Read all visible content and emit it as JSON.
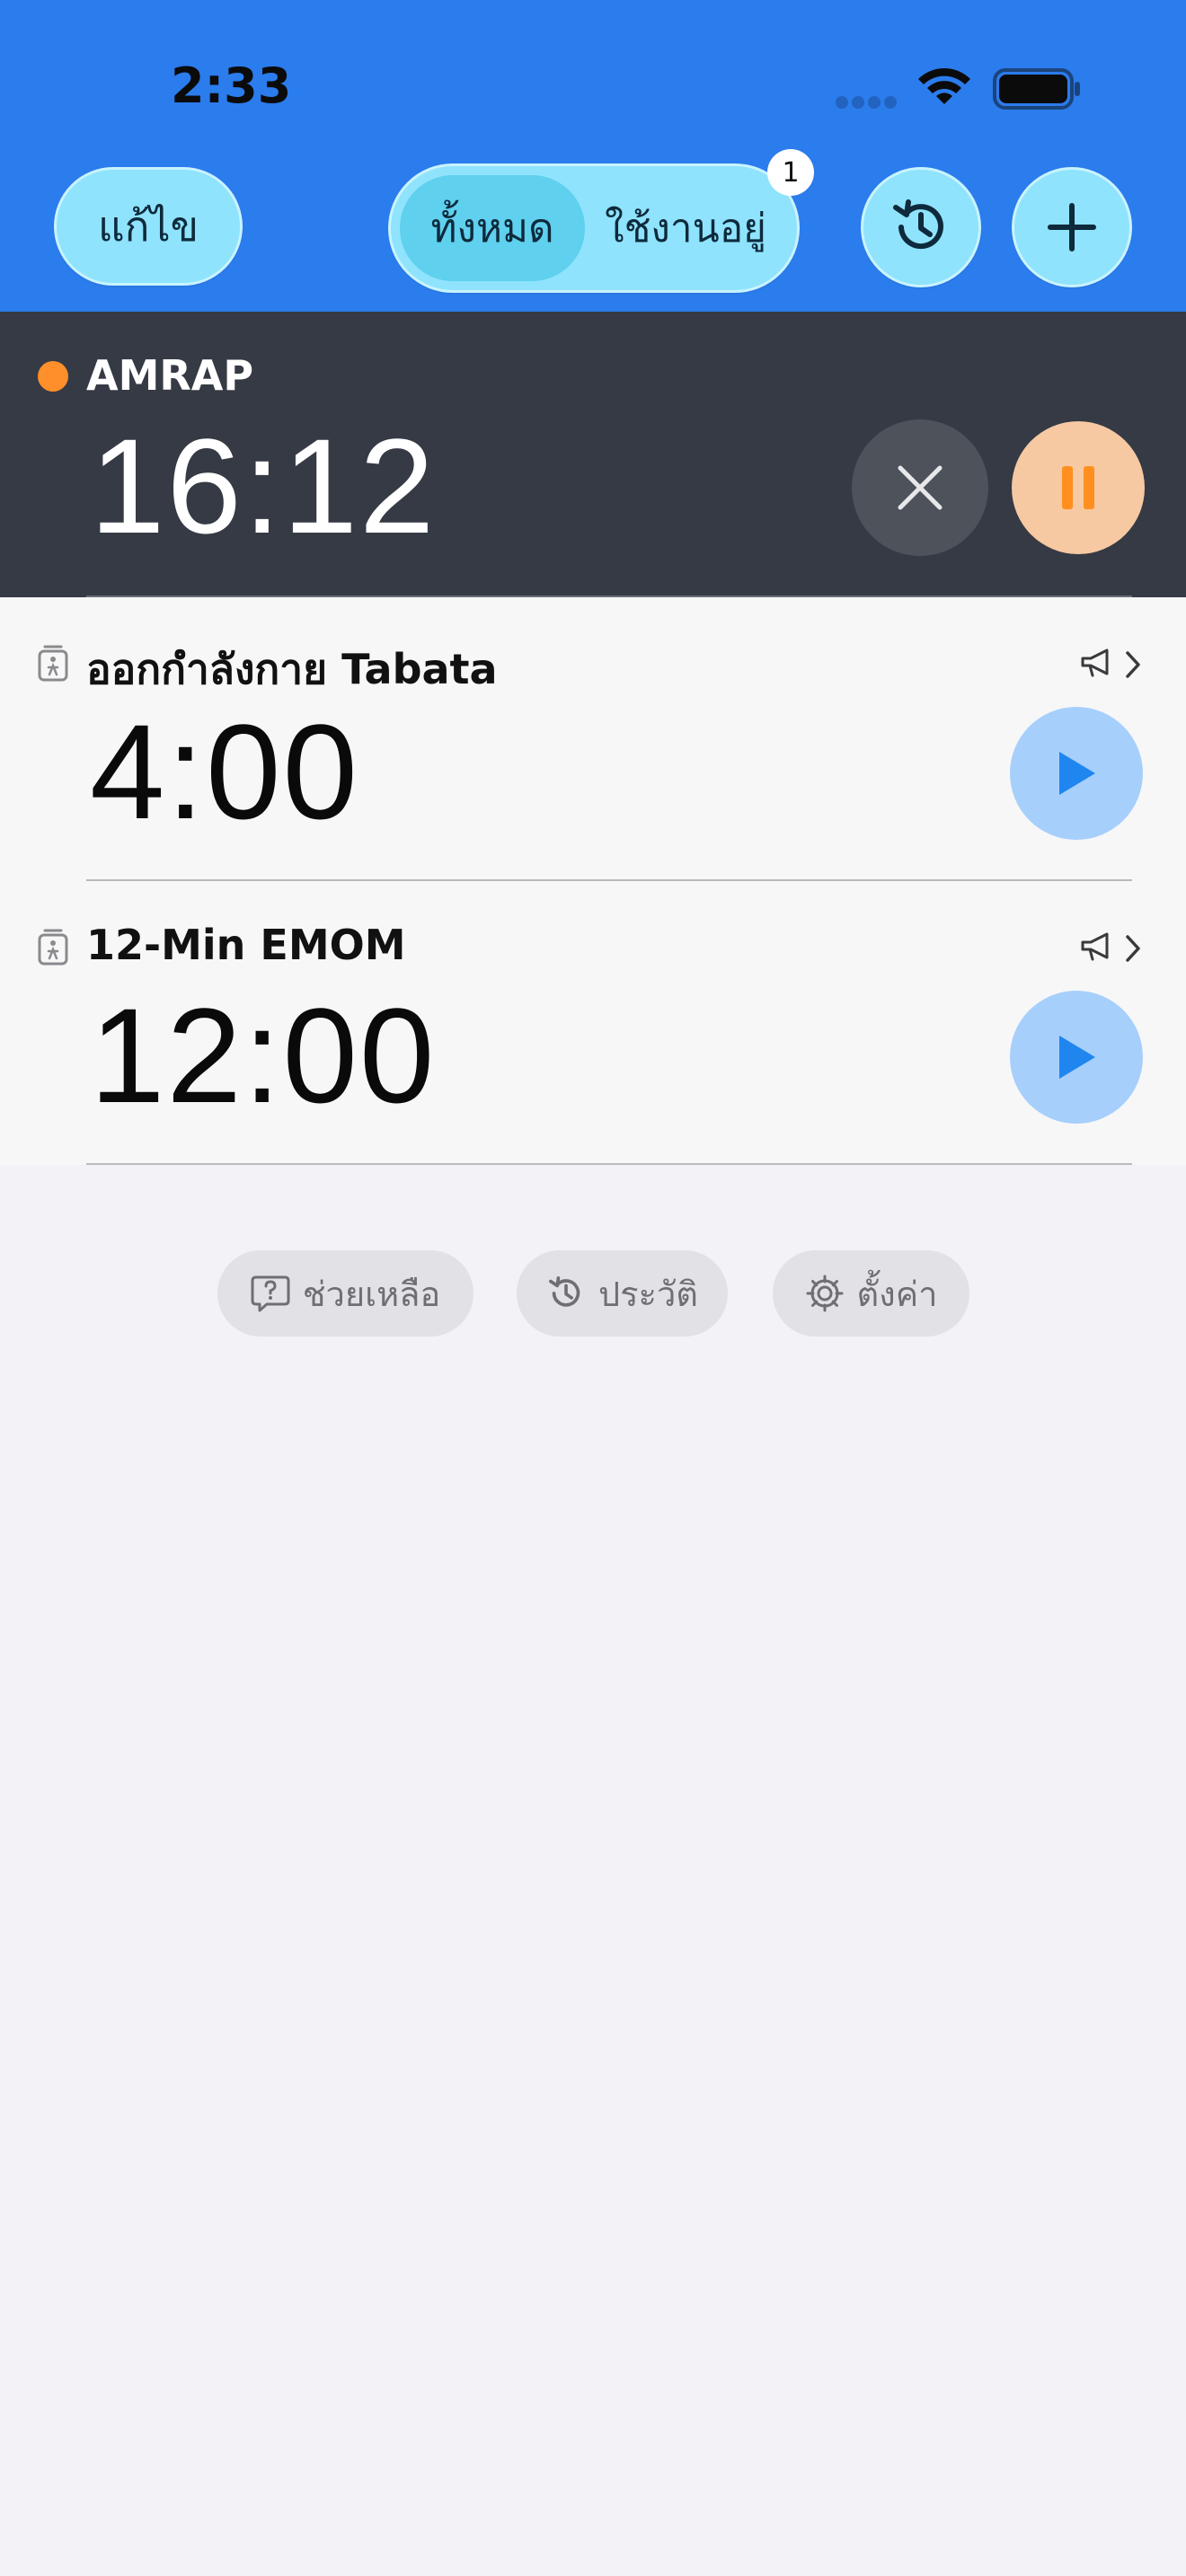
{
  "status_bar": {
    "time": "2:33"
  },
  "header": {
    "edit_label": "แก้ไข",
    "segments": [
      {
        "label": "ทั้งหมด",
        "selected": true
      },
      {
        "label": "ใช้งานอยู่",
        "selected": false
      }
    ],
    "active_badge": "1",
    "colors": {
      "background": "#2b7cec",
      "pill": "#8fe3fc",
      "selected_segment": "#5fd0ee"
    }
  },
  "timers": [
    {
      "name": "AMRAP",
      "time": "16:12",
      "state": "running",
      "icon": "status-dot"
    },
    {
      "name": "ออกกำลังกาย Tabata",
      "time": "4:00",
      "state": "idle",
      "icon": "timer-icon"
    },
    {
      "name": "12-Min EMOM",
      "time": "12:00",
      "state": "idle",
      "icon": "timer-icon"
    }
  ],
  "footer": {
    "help_label": "ช่วยเหลือ",
    "history_label": "ประวัติ",
    "settings_label": "ตั้งค่า"
  },
  "icons": [
    "wifi-icon",
    "battery-icon",
    "history-icon",
    "plus-icon",
    "close-icon",
    "pause-icon",
    "play-icon",
    "megaphone-icon",
    "chevron-right-icon",
    "help-icon",
    "gear-icon"
  ]
}
